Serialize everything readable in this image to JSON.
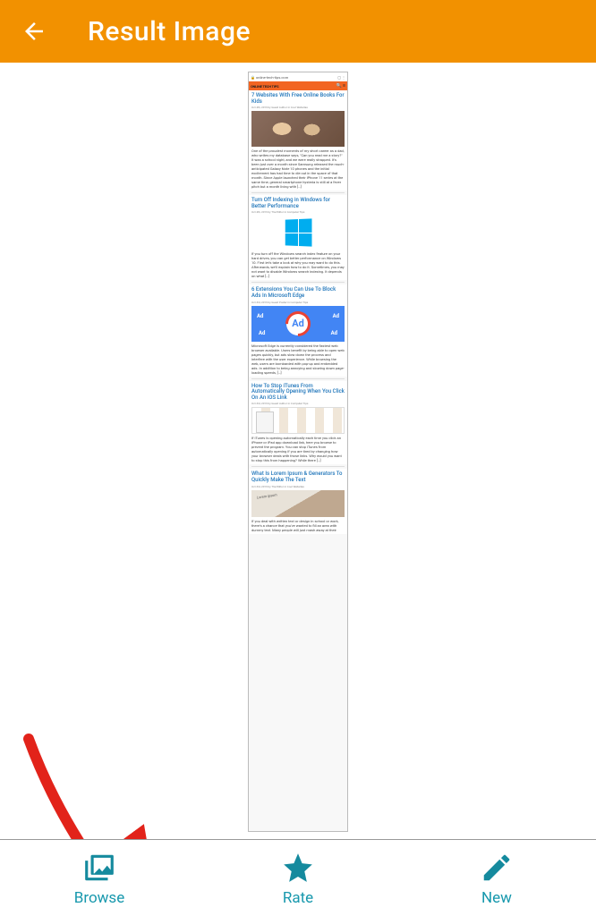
{
  "header": {
    "title": "Result Image"
  },
  "bottom": {
    "browse": "Browse",
    "rate": "Rate",
    "new": "New"
  },
  "preview": {
    "url": "online-tech-tips.com",
    "site_logo": "ONLINE TECH TIPS",
    "articles": [
      {
        "title": "7 Websites With Free Online Books For Kids",
        "meta": "Oct 4th, 2019 by Guest Author in Cool Websites",
        "body": "One of the proudest moments of my short career as a dad, who writes my database says, \"Can you read me a story?\" It was a school night, and we were really strapped. It's been just over a month since Samsung released the much-anticipated Galaxy Note 10 phones and the initial excitement has had time to die out in the space of that month. Since Apple launched their iPhone 11 series at the same time, general smartphone hysteria is still at a fever pitch but a month living with […]"
      },
      {
        "title": "Turn Off Indexing in Windows for Better Performance",
        "meta": "Oct 4th, 2019 by The Editor in Computer Tips",
        "body": "If you turn off the Windows search index feature on your hard drives, you can get better performance on Windows 10. First let's take a look at why you may want to do this. Afterwards, we'll explain how to do it. Sometimes, you may not want to disable Windows search indexing. It depends on what […]"
      },
      {
        "title": "6 Extensions You Can Use To Block Ads In Microsoft Edge",
        "meta": "Oct 3rd, 2019 by Guest Poster in Computer Tips",
        "body": "Microsoft Edge is currently considered the fastest web browser available. Users benefit by being able to open web pages quickly, but ads slow down the process and interfere with the user experience. While browsing the web, users are bombarded with pop-up and embedded ads. In addition to being annoying and slowing down page-loading speeds, […]"
      },
      {
        "title": "How To Stop iTunes From Automatically Opening When You Click On An iOS Link",
        "meta": "Oct 3rd, 2019 by Guest Author in Computer Tips",
        "body": "If iTunes is opening automatically each time you click an iPhone or iPad app download link, here you browse to prevent the program. You can stop iTunes from automatically opening if you are tired by changing how your browser deals with those links. Why would you want to stop this from happening? While there […]"
      },
      {
        "title": "What Is Lorem Ipsum & Generators To Quickly Make The Text",
        "meta": "Oct 3rd, 2019 by The Editor in Cool Websites",
        "body": "If you deal with written text or design in school or work, there's a chance that you've wanted to fill an area with dummy text. Many people will just mash away at their"
      }
    ]
  }
}
